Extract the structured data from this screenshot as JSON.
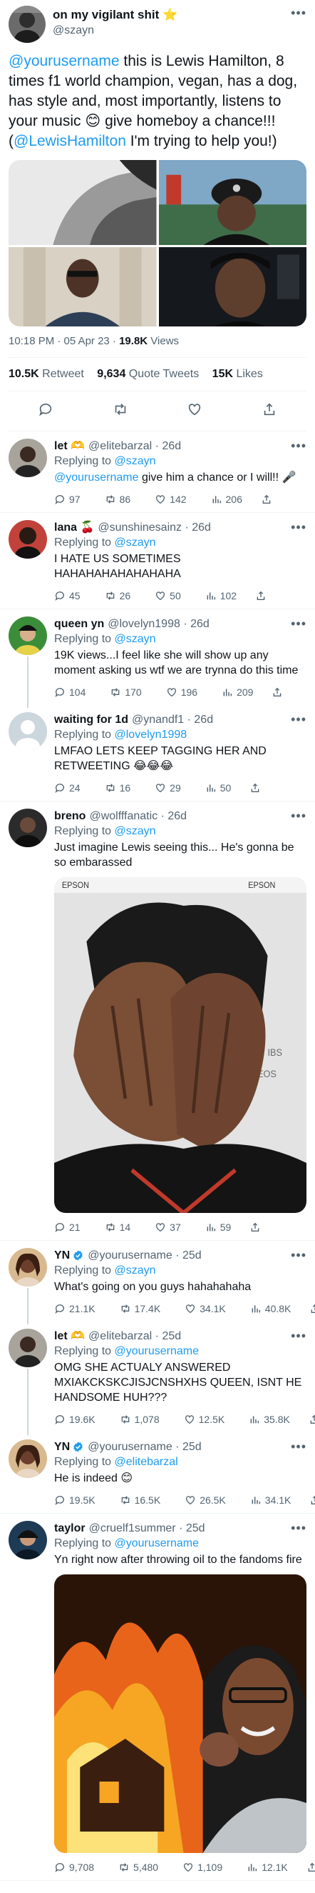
{
  "main_tweet": {
    "display_name": "on my vigilant shit",
    "name_emoji": "⭐",
    "handle": "@szayn",
    "text_mention": "@yourusername",
    "text_part1": " this is Lewis Hamilton, 8 times f1 world champion, vegan, has a dog, has style and, most importantly, listens to your music 😊 give homeboy a chance!!! (",
    "text_mention2": "@LewisHamilton",
    "text_part2": " I'm trying to help you!)",
    "time": "10:18 PM · 05 Apr 23 · ",
    "views_count": "19.8K",
    "views_label": " Views",
    "retweets_count": "10.5K",
    "retweets_label": " Retweet",
    "quotes_count": "9,634",
    "quotes_label": " Quote Tweets",
    "likes_count": "15K",
    "likes_label": " Likes"
  },
  "replies": [
    {
      "name": "let 🫶",
      "handle": "@elitebarzal",
      "age": "26d",
      "replying_label": "Replying to ",
      "replying_to": "@szayn",
      "text_mention": "@yourusername",
      "text": " give him a chance or I will!! 🎤",
      "replies": "97",
      "retweets": "86",
      "likes": "142",
      "views": "206"
    },
    {
      "name": "lana 🍒",
      "handle": "@sunshinesainz",
      "age": "26d",
      "replying_label": "Replying to ",
      "replying_to": "@szayn",
      "text": "I HATE US SOMETIMES HAHAHAHAHAHAHAHA",
      "replies": "45",
      "retweets": "26",
      "likes": "50",
      "views": "102"
    },
    {
      "name": "queen yn",
      "handle": "@lovelyn1998",
      "age": "26d",
      "replying_label": "Replying to ",
      "replying_to": "@szayn",
      "text": "19K views...I feel like she will show up any moment asking us wtf we are trynna do this time",
      "replies": "104",
      "retweets": "170",
      "likes": "196",
      "views": "209"
    },
    {
      "name": "waiting for 1d",
      "handle": "@ynandf1",
      "age": "26d",
      "replying_label": "Replying to ",
      "replying_to": "@lovelyn1998",
      "text": "LMFAO LETS KEEP TAGGING HER AND RETWEETING 😂😂😂",
      "replies": "24",
      "retweets": "16",
      "likes": "29",
      "views": "50"
    },
    {
      "name": "breno",
      "handle": "@wolfffanatic",
      "age": "26d",
      "replying_label": "Replying to ",
      "replying_to": "@szayn",
      "text": "Just imagine Lewis seeing this... He's gonna be so embarassed",
      "media_text": [
        "EPSON",
        "IBS",
        "INEOS"
      ],
      "replies": "21",
      "retweets": "14",
      "likes": "37",
      "views": "59"
    },
    {
      "name": "YN",
      "handle": "@yourusername",
      "age": "25d",
      "replying_label": "Replying to ",
      "replying_to": "@szayn",
      "text": "What's going on you guys hahahahaha",
      "replies": "21.1K",
      "retweets": "17.4K",
      "likes": "34.1K",
      "views": "40.8K"
    },
    {
      "name": "let 🫶",
      "handle": "@elitebarzal",
      "age": "25d",
      "replying_label": "Replying to ",
      "replying_to": "@yourusername",
      "text": "OMG SHE ACTUALY ANSWERED MXIAKCKSKCJISJCNSHXHS QUEEN, ISNT HE HANDSOME HUH???",
      "replies": "19.6K",
      "retweets": "1,078",
      "likes": "12.5K",
      "views": "35.8K"
    },
    {
      "name": "YN",
      "handle": "@yourusername",
      "age": "25d",
      "replying_label": "Replying to ",
      "replying_to": "@elitebarzal",
      "text": "He is indeed 😊",
      "replies": "19.5K",
      "retweets": "16.5K",
      "likes": "26.5K",
      "views": "34.1K"
    },
    {
      "name": "taylor",
      "handle": "@cruelf1summer",
      "age": "25d",
      "replying_label": "Replying to ",
      "replying_to": "@yourusername",
      "text": "Yn right now after throwing oil to the fandoms fire",
      "replies": "9,708",
      "retweets": "5,480",
      "likes": "1,109",
      "views": "12.1K"
    }
  ],
  "icons": {
    "reply": "reply-icon",
    "retweet": "retweet-icon",
    "like": "like-icon",
    "views": "views-icon",
    "share": "share-icon",
    "verified": "verified-badge-icon",
    "more": "more-icon"
  },
  "colors": {
    "accent": "#1d9bf0",
    "secondary_text": "#536471",
    "divider": "#eff3f4"
  }
}
